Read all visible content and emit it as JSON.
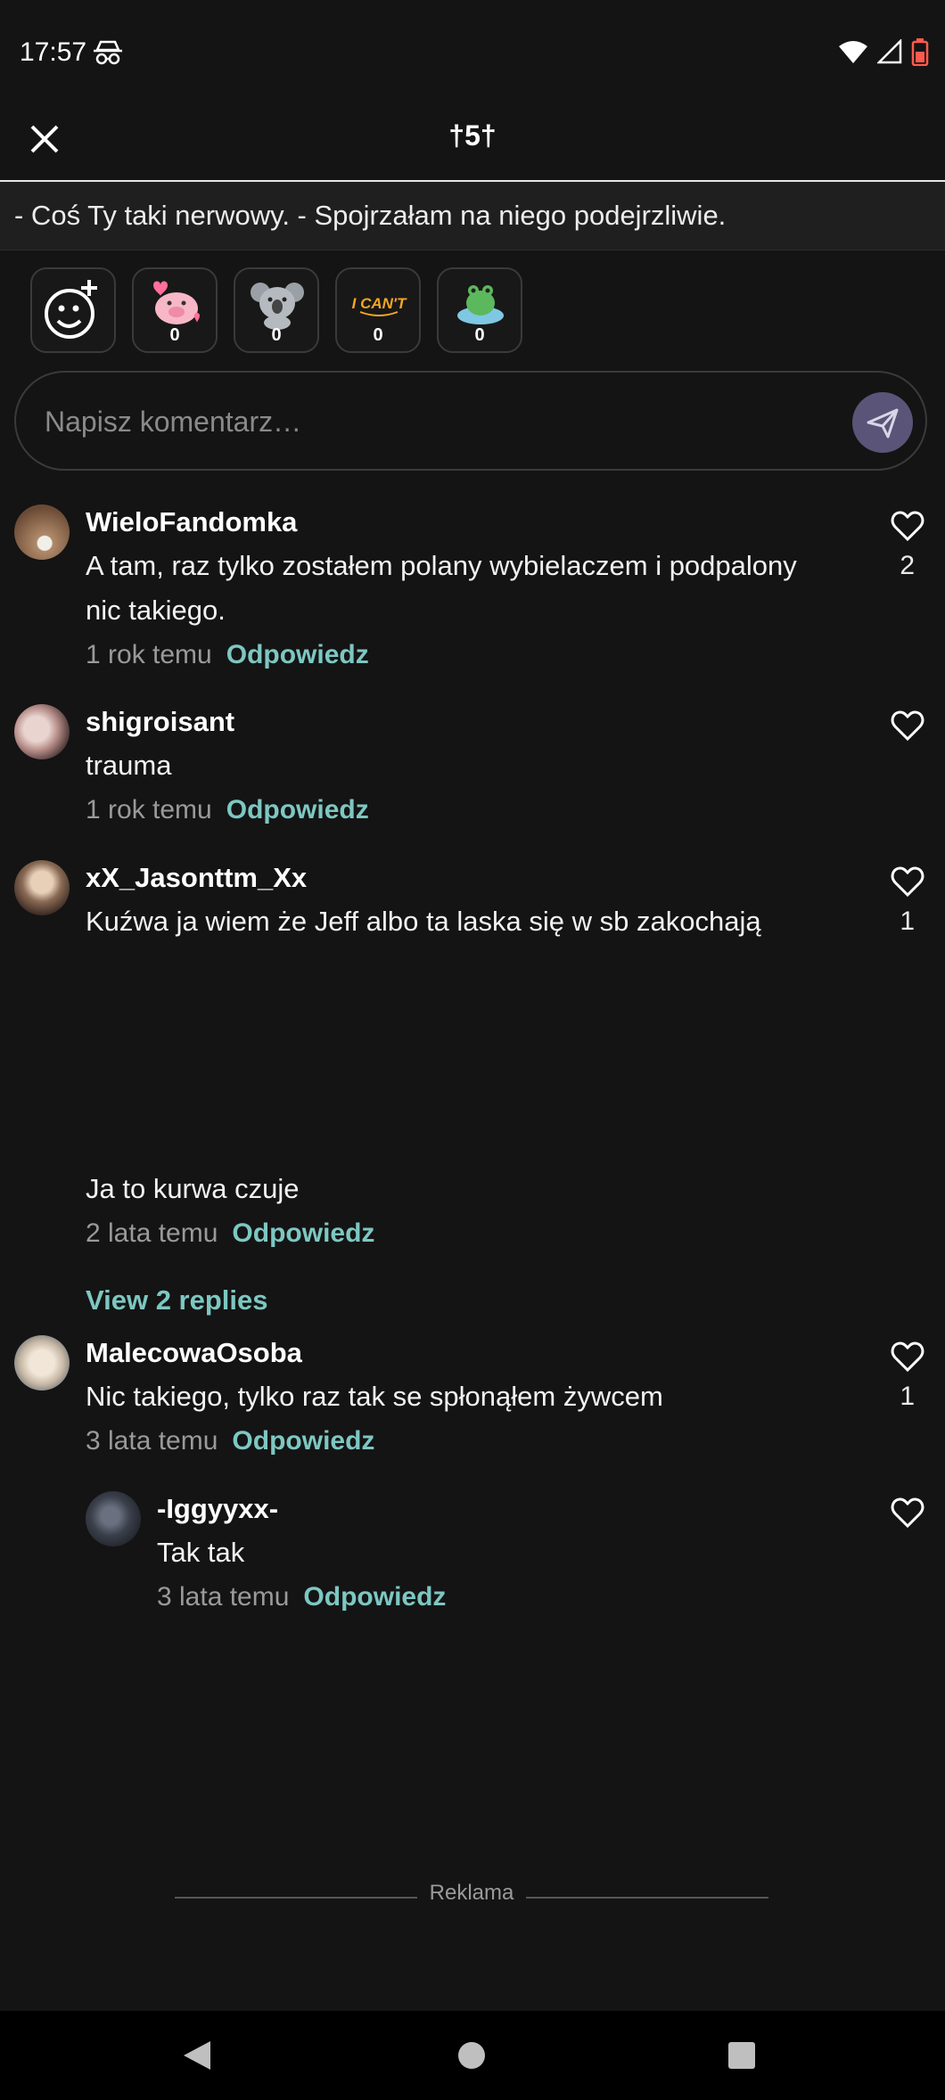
{
  "status_bar": {
    "time": "17:57"
  },
  "header": {
    "title": "†5†",
    "close_icon": "close-icon"
  },
  "quote": "- Coś Ty taki nerwowy. - Spojrzałam na niego podejrzliwie.",
  "reactions": [
    {
      "icon": "add-reaction-icon",
      "count": null
    },
    {
      "icon": "pig-sticker-icon",
      "count": "0"
    },
    {
      "icon": "koala-sticker-icon",
      "count": "0"
    },
    {
      "icon": "i-cant-sticker-icon",
      "count": "0"
    },
    {
      "icon": "frog-sticker-icon",
      "count": "0"
    }
  ],
  "composer": {
    "placeholder": "Napisz komentarz…"
  },
  "comments": [
    {
      "author": "WieloFandomka",
      "text_lines": [
        "A tam, raz tylko zostałem polany wybielaczem i podpalony",
        "nic takiego."
      ],
      "time": "1 rok temu",
      "reply": "Odpowiedz",
      "likes": "2"
    },
    {
      "author": "shigroisant",
      "text_lines": [
        "trauma"
      ],
      "time": "1 rok temu",
      "reply": "Odpowiedz",
      "likes": ""
    },
    {
      "author": "xX_Jasonttm_Xx",
      "text_lines": [
        "Kuźwa ja wiem że Jeff albo ta laska się w sb zakochają",
        "Ja to kurwa czuje"
      ],
      "time": "2 lata temu",
      "reply": "Odpowiedz",
      "likes": "1",
      "view_replies": "View 2 replies"
    },
    {
      "author": "MalecowaOsoba",
      "text_lines": [
        "Nic takiego, tylko raz tak se spłonąłem żywcem"
      ],
      "time": "3 lata temu",
      "reply": "Odpowiedz",
      "likes": "1"
    },
    {
      "author": "-Iggyyxx-",
      "text_lines": [
        "Tak tak"
      ],
      "time": "3 lata temu",
      "reply": "Odpowiedz",
      "likes": ""
    }
  ],
  "ad_label": "Reklama",
  "colors": {
    "background": "#141414",
    "accent_teal": "#7dc7c2",
    "send_button": "#5a5478"
  }
}
